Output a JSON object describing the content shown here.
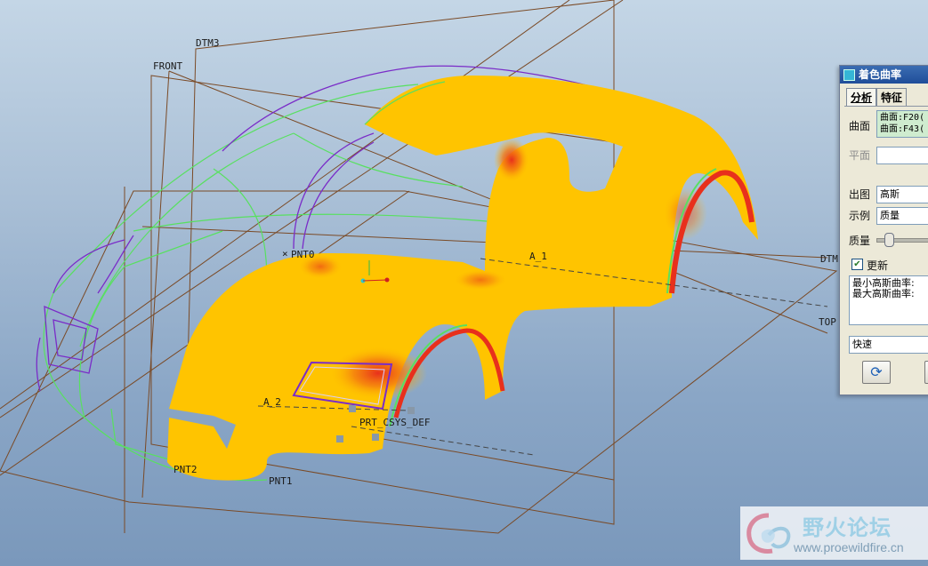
{
  "viewport": {
    "datum_labels": {
      "dtm3": "DTM3",
      "front": "FRONT",
      "dtm_right": "DTM",
      "top": "TOP",
      "pnt0": "PNT0",
      "pnt1": "PNT1",
      "pnt2": "PNT2",
      "axis_1": "A_1",
      "axis_2": "A_2",
      "csys": "PRT_CSYS_DEF"
    },
    "colors": {
      "surface": "#ffc400",
      "curvature_high": "#e8301c",
      "curves_green": "#58e060",
      "curves_purple": "#7a2cc8",
      "datum_planes": "#7a4a26"
    }
  },
  "dialog": {
    "title": "着色曲率",
    "tabs": {
      "analysis": "分析",
      "feature": "特征"
    },
    "surface_label": "曲面",
    "surfaces": [
      "曲面:F20(",
      "曲面:F43("
    ],
    "plane_label": "平面",
    "output_label": "出图",
    "output_value": "高斯",
    "sample_label": "示例",
    "sample_value": "质量",
    "quality_label": "质量",
    "quality_level": 0.15,
    "update_label": "更新",
    "result_text": "最小高斯曲率:\n最大高斯曲率:",
    "mode_value": "快速",
    "compute_icon": "refresh-icon"
  },
  "watermark": {
    "title": "野火论坛",
    "url": "www.proewildfire.cn"
  }
}
